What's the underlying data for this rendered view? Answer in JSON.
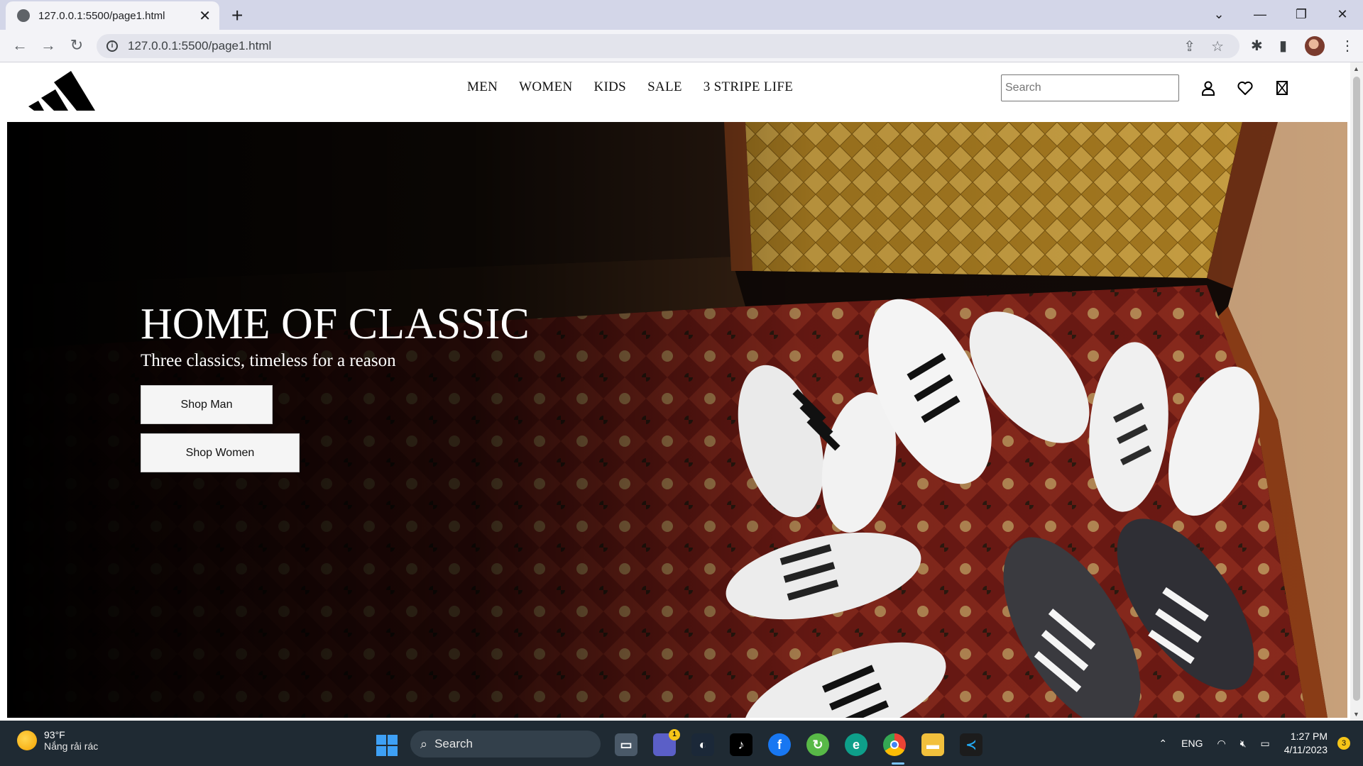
{
  "browser": {
    "tab_title": "127.0.0.1:5500/page1.html",
    "url": "127.0.0.1:5500/page1.html"
  },
  "header": {
    "nav": [
      "MEN",
      "WOMEN",
      "KIDS",
      "SALE",
      "3 STRIPE LIFE"
    ],
    "search_placeholder": "Search"
  },
  "hero": {
    "title": "HOME OF CLASSIC",
    "subtitle": "Three classics, timeless for a reason",
    "btn_man": "Shop Man",
    "btn_women": "Shop Women"
  },
  "taskbar": {
    "weather_temp": "93°F",
    "weather_desc": "Nắng rải rác",
    "search_label": "Search",
    "chat_badge": "1",
    "language": "ENG",
    "time": "1:27 PM",
    "date": "4/11/2023",
    "notification_count": "3"
  },
  "icons": {
    "tab": "globe-icon",
    "header": [
      "account-icon",
      "heart-icon",
      "bag-icon"
    ],
    "taskbar_apps": [
      "task-view-icon",
      "chat-icon",
      "steam-icon",
      "tiktok-icon",
      "facebook-icon",
      "app-icon",
      "edge-icon",
      "chrome-icon",
      "file-explorer-icon",
      "vscode-icon"
    ]
  }
}
